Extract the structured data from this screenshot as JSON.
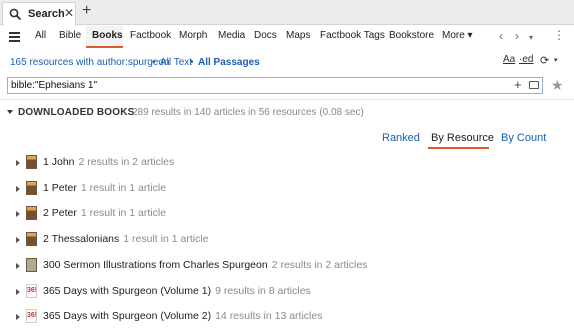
{
  "tab": {
    "label": "Search",
    "close": "✕",
    "new": "+"
  },
  "toolbar": {
    "items": [
      "All",
      "Bible",
      "Books",
      "Factbook",
      "Morph",
      "Media",
      "Docs",
      "Maps",
      "Factbook Tags",
      "Bookstore",
      "More ▾"
    ],
    "active": "Books"
  },
  "resources": {
    "count_text": "165 resources with author:spurgeon",
    "sep1": "•",
    "scope1": "All Text",
    "sep2": "•",
    "scope2": "All Passages",
    "icon_aa": "Aa",
    "icon_ed": "·ed",
    "icon_cycle": "⟳"
  },
  "search": {
    "value": "bible:\"Ephesians 1\"",
    "plus": "+"
  },
  "section": {
    "title": "DOWNLOADED BOOKS",
    "summary": "289 results in 140 articles in 56 resources (0.08 sec)"
  },
  "sort": {
    "ranked": "Ranked",
    "by_resource": "By Resource",
    "by_count": "By Count"
  },
  "results": [
    {
      "title": "1 John",
      "count": "2 results in 2 articles"
    },
    {
      "title": "1 Peter",
      "count": "1 result in 1 article"
    },
    {
      "title": "2 Peter",
      "count": "1 result in 1 article"
    },
    {
      "title": "2 Thessalonians",
      "count": "1 result in 1 article"
    },
    {
      "title": "300 Sermon Illustrations from Charles Spurgeon",
      "count": "2 results in 2 articles"
    },
    {
      "title": "365 Days with Spurgeon (Volume 1)",
      "count": "9 results in 8 articles"
    },
    {
      "title": "365 Days with Spurgeon (Volume 2)",
      "count": "14 results in 13 articles"
    }
  ],
  "cover_365_text": "365"
}
